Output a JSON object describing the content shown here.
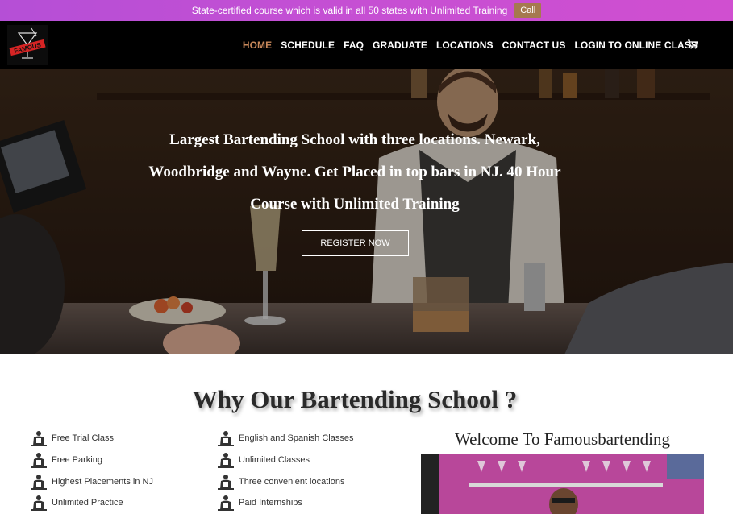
{
  "announcement": {
    "text": "State-certified course which is valid in all 50 states with Unlimited Training",
    "call_label": "Call"
  },
  "header": {
    "logo_text": "FAMOUS",
    "nav": [
      {
        "label": "HOME",
        "active": true
      },
      {
        "label": "SCHEDULE",
        "active": false
      },
      {
        "label": "FAQ",
        "active": false
      },
      {
        "label": "GRADUATE",
        "active": false
      },
      {
        "label": "LOCATIONS",
        "active": false
      },
      {
        "label": "CONTACT US",
        "active": false
      },
      {
        "label": "LOGIN TO ONLINE CLASS",
        "active": false
      }
    ],
    "cart_icon": "cart-icon"
  },
  "hero": {
    "title": "Largest Bartending School with three locations. Newark, Woodbridge and Wayne. Get Placed in top bars in NJ. 40 Hour Course with Unlimited Training",
    "cta_label": "REGISTER NOW"
  },
  "features": {
    "title": "Why Our Bartending School ?",
    "left": [
      "Free Trial Class",
      "Free Parking",
      "Highest Placements in NJ",
      "Unlimited Practice"
    ],
    "right": [
      "English and Spanish Classes",
      "Unlimited Classes",
      "Three convenient locations",
      "Paid Internships"
    ],
    "icon": "bartender-icon"
  },
  "welcome": {
    "title": "Welcome To Famousbartending"
  },
  "colors": {
    "topbar": "#c64fd3",
    "call_button": "#a5794f",
    "nav_active": "#c9895b",
    "header_bg": "#000000"
  }
}
